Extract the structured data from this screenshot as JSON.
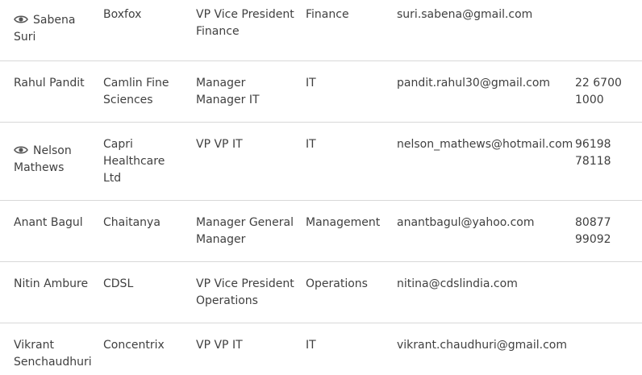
{
  "contacts": [
    {
      "name": "Sabena Suri",
      "has_view_icon": true,
      "company": "Boxfox",
      "designation": "VP Vice President Finance",
      "department": "Finance",
      "email": "suri.sabena@gmail.com",
      "phone": ""
    },
    {
      "name": "Rahul Pandit",
      "has_view_icon": false,
      "company": "Camlin Fine Sciences",
      "designation": "Manager Manager IT",
      "department": "IT",
      "email": "pandit.rahul30@gmail.com",
      "phone": "22 6700 1000"
    },
    {
      "name": "Nelson Mathews",
      "has_view_icon": true,
      "company": "Capri Healthcare Ltd",
      "designation": "VP VP IT",
      "department": "IT",
      "email": "nelson_mathews@hotmail.com",
      "phone": "96198 78118"
    },
    {
      "name": "Anant Bagul",
      "has_view_icon": false,
      "company": "Chaitanya",
      "designation": "Manager General Manager",
      "department": "Management",
      "email": "anantbagul@yahoo.com",
      "phone": "80877 99092"
    },
    {
      "name": "Nitin Ambure",
      "has_view_icon": false,
      "company": "CDSL",
      "designation": "VP Vice President Operations",
      "department": "Operations",
      "email": "nitina@cdslindia.com",
      "phone": ""
    },
    {
      "name": "Vikrant Senchaudhuri",
      "has_view_icon": false,
      "company": "Concentrix",
      "designation": "VP VP IT",
      "department": "IT",
      "email": "vikrant.chaudhuri@gmail.com",
      "phone": ""
    }
  ],
  "colors": {
    "text": "#404040",
    "divider": "#d8d8d8",
    "icon": "#555555"
  },
  "icons": {
    "view": "eye-icon"
  }
}
